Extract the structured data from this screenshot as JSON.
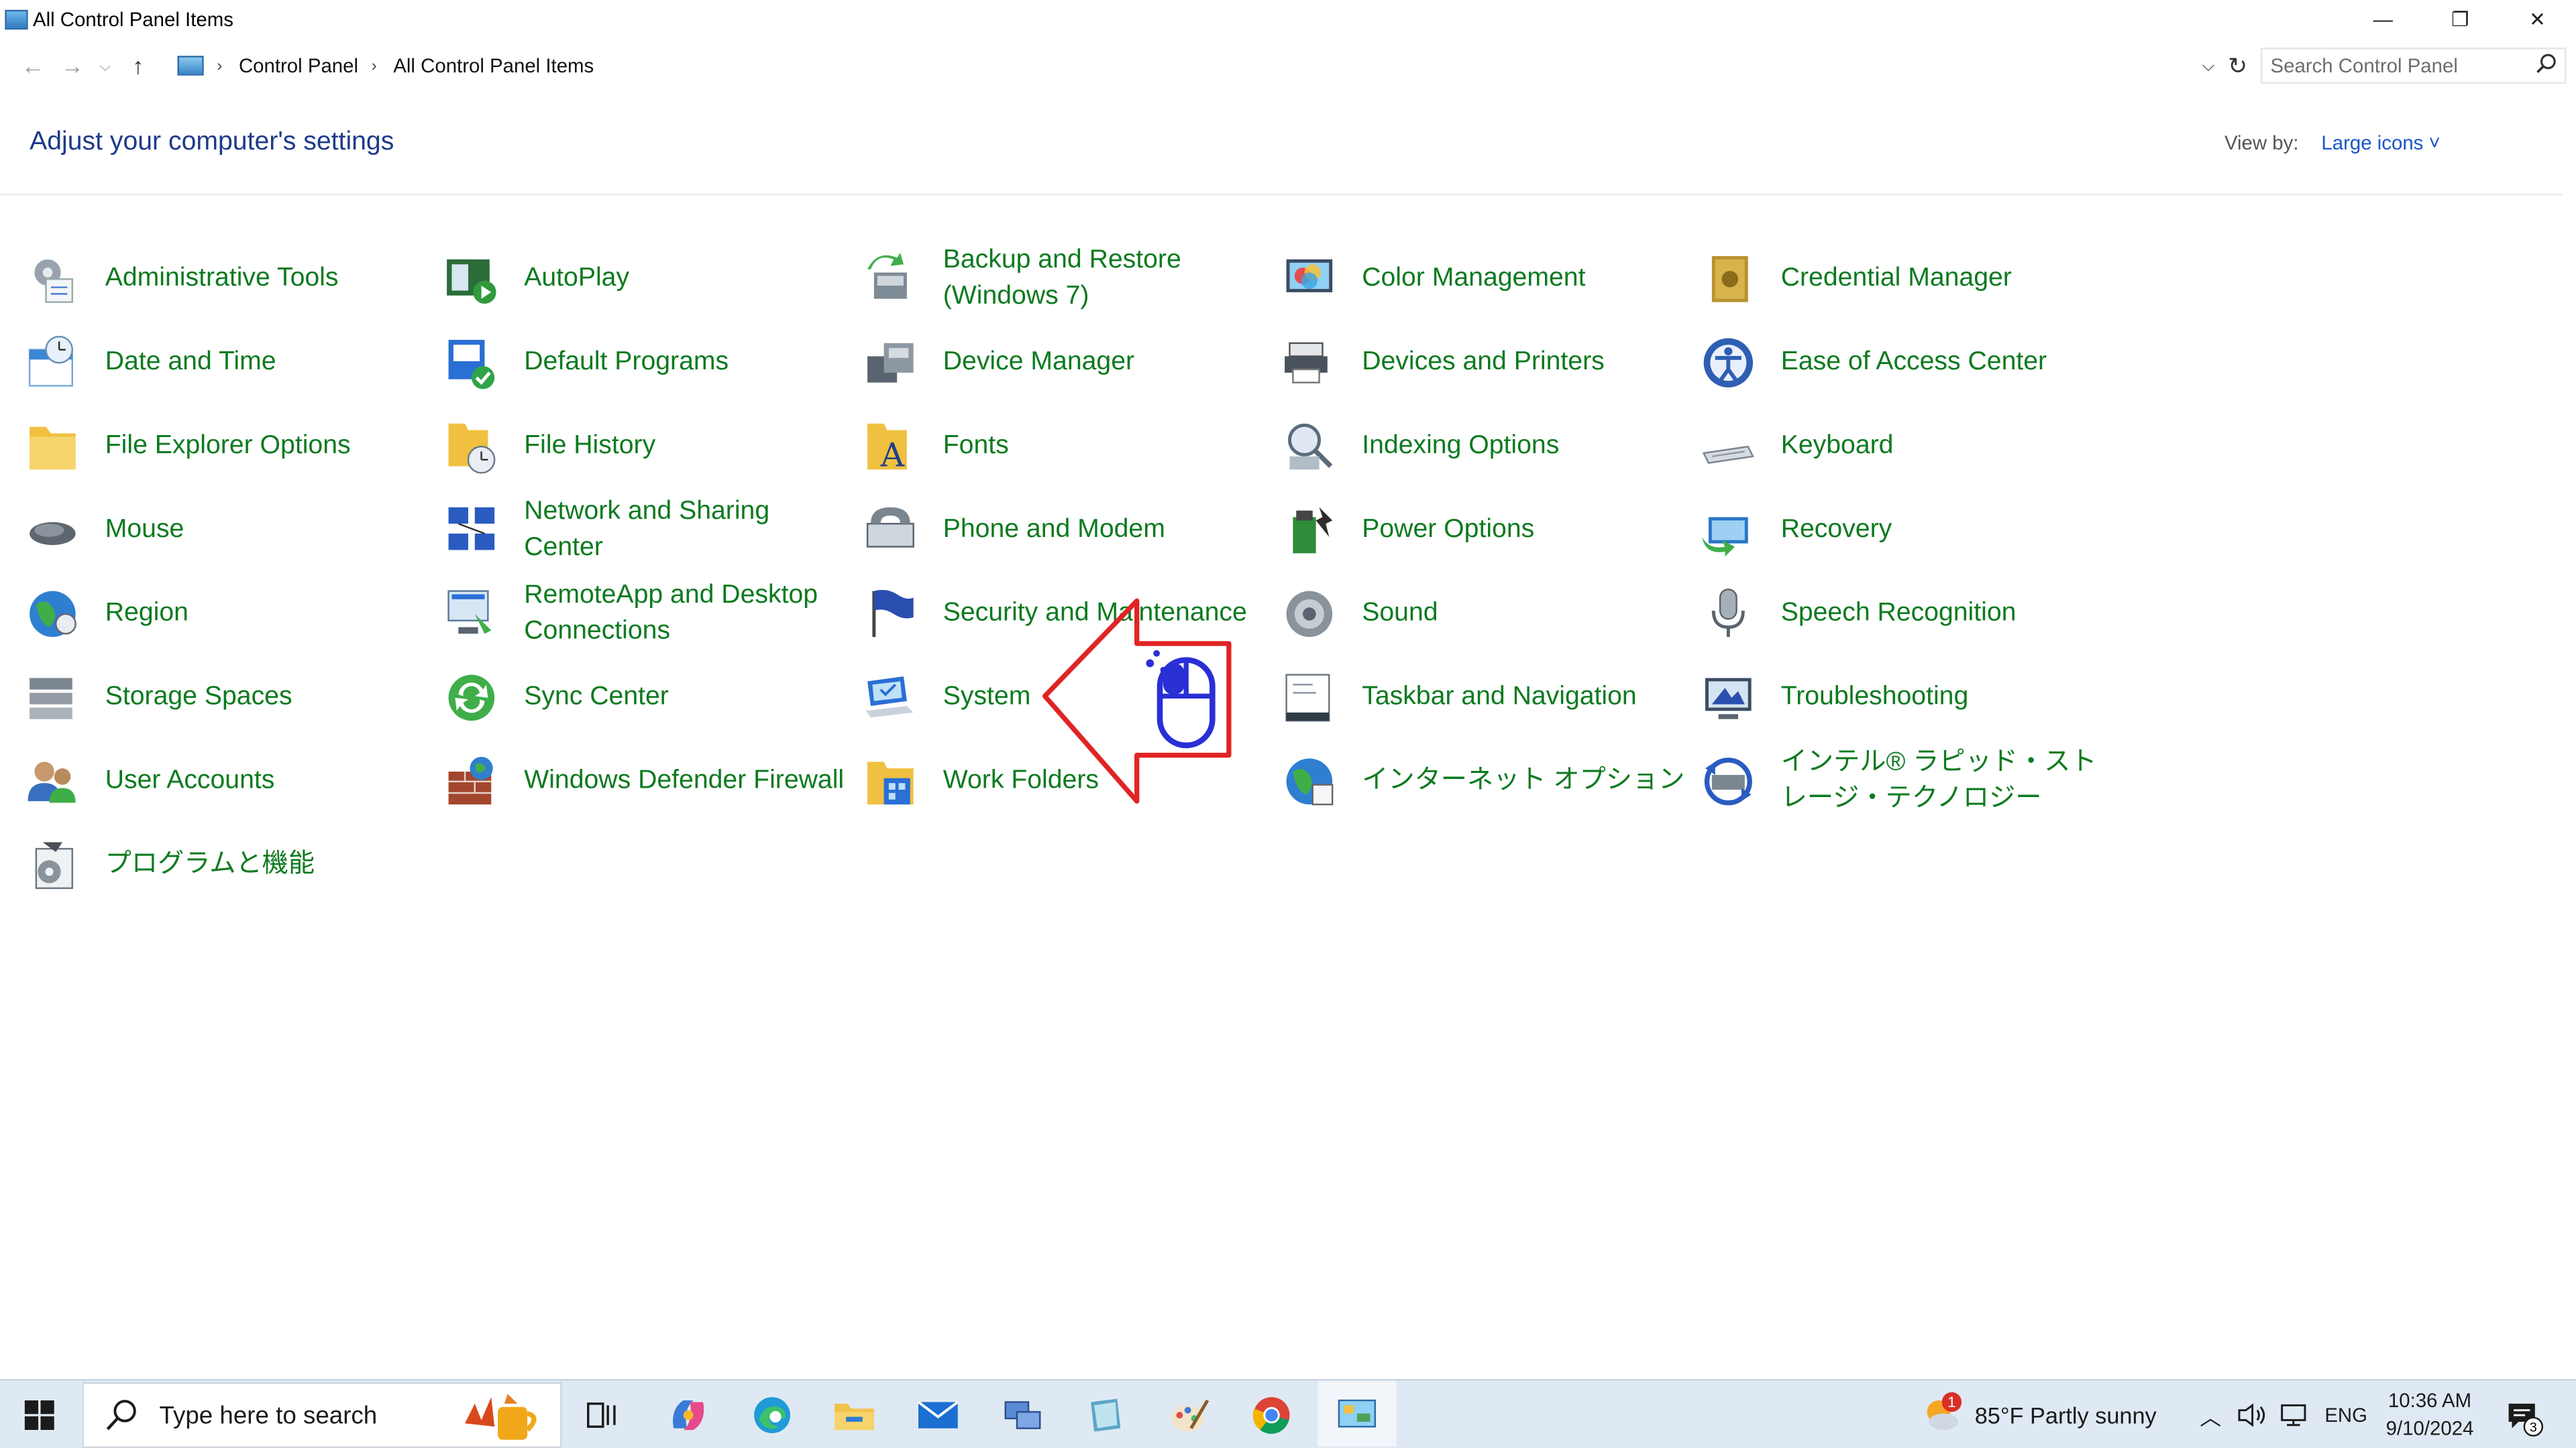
{
  "window": {
    "title": "All Control Panel Items",
    "minimize_glyph": "—",
    "restore_glyph": "❐",
    "close_glyph": "✕"
  },
  "address": {
    "crumbs": [
      "Control Panel",
      "All Control Panel Items"
    ],
    "search_placeholder": "Search Control Panel"
  },
  "header": {
    "title": "Adjust your computer's settings",
    "view_by_label": "View by:",
    "view_by_value": "Large icons ˅"
  },
  "items": [
    {
      "label": "Administrative Tools",
      "icon": "admin-tools-icon"
    },
    {
      "label": "AutoPlay",
      "icon": "autoplay-icon"
    },
    {
      "label": "Backup and Restore (Windows 7)",
      "icon": "backup-restore-icon"
    },
    {
      "label": "Color Management",
      "icon": "color-management-icon"
    },
    {
      "label": "Credential Manager",
      "icon": "credential-manager-icon"
    },
    {
      "label": "Date and Time",
      "icon": "date-time-icon"
    },
    {
      "label": "Default Programs",
      "icon": "default-programs-icon"
    },
    {
      "label": "Device Manager",
      "icon": "device-manager-icon"
    },
    {
      "label": "Devices and Printers",
      "icon": "devices-printers-icon"
    },
    {
      "label": "Ease of Access Center",
      "icon": "ease-of-access-icon"
    },
    {
      "label": "File Explorer Options",
      "icon": "file-explorer-options-icon"
    },
    {
      "label": "File History",
      "icon": "file-history-icon"
    },
    {
      "label": "Fonts",
      "icon": "fonts-icon"
    },
    {
      "label": "Indexing Options",
      "icon": "indexing-options-icon"
    },
    {
      "label": "Keyboard",
      "icon": "keyboard-icon"
    },
    {
      "label": "Mouse",
      "icon": "mouse-icon"
    },
    {
      "label": "Network and Sharing Center",
      "icon": "network-sharing-icon"
    },
    {
      "label": "Phone and Modem",
      "icon": "phone-modem-icon"
    },
    {
      "label": "Power Options",
      "icon": "power-options-icon"
    },
    {
      "label": "Recovery",
      "icon": "recovery-icon"
    },
    {
      "label": "Region",
      "icon": "region-icon"
    },
    {
      "label": "RemoteApp and Desktop Connections",
      "icon": "remoteapp-icon"
    },
    {
      "label": "Security and Maintenance",
      "icon": "security-maintenance-icon"
    },
    {
      "label": "Sound",
      "icon": "sound-icon"
    },
    {
      "label": "Speech Recognition",
      "icon": "speech-recognition-icon"
    },
    {
      "label": "Storage Spaces",
      "icon": "storage-spaces-icon"
    },
    {
      "label": "Sync Center",
      "icon": "sync-center-icon"
    },
    {
      "label": "System",
      "icon": "system-icon"
    },
    {
      "label": "Taskbar and Navigation",
      "icon": "taskbar-navigation-icon"
    },
    {
      "label": "Troubleshooting",
      "icon": "troubleshooting-icon"
    },
    {
      "label": "User Accounts",
      "icon": "user-accounts-icon"
    },
    {
      "label": "Windows Defender Firewall",
      "icon": "firewall-icon"
    },
    {
      "label": "Work Folders",
      "icon": "work-folders-icon"
    },
    {
      "label": "インターネット オプション",
      "icon": "internet-options-icon"
    },
    {
      "label": "インテル® ラピッド・ストレージ・テクノロジー",
      "icon": "intel-rst-icon"
    },
    {
      "label": "プログラムと機能",
      "icon": "programs-features-icon"
    }
  ],
  "taskbar": {
    "search_placeholder": "Type here to search",
    "weather": "85°F  Partly sunny",
    "weather_badge": "1",
    "language": "ENG",
    "time": "10:36 AM",
    "date": "9/10/2024",
    "notification_count": "3"
  },
  "colors": {
    "link_green": "#0c7a1f",
    "title_blue": "#1e3a8a",
    "arrow_red": "#e02424",
    "mouse_blue": "#2a2fd6"
  }
}
